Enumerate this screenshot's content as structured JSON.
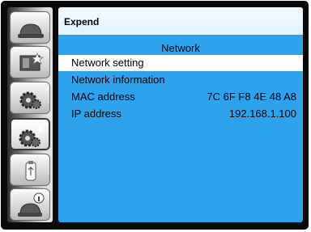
{
  "sidebar": {
    "items": [
      {
        "name": "display-icon"
      },
      {
        "name": "picture-icon"
      },
      {
        "name": "settings-gear-icon"
      },
      {
        "name": "expand-gear-icon"
      },
      {
        "name": "usb-icon"
      },
      {
        "name": "info-icon"
      }
    ]
  },
  "panel": {
    "title": "Expend",
    "section_title": "Network",
    "rows": [
      {
        "label": "Network setting",
        "value": ""
      },
      {
        "label": "Network information",
        "value": ""
      },
      {
        "label": "MAC address",
        "value": "7C 6F F8 4E 48 A8"
      },
      {
        "label": "IP address",
        "value": "192.168.1.100"
      }
    ],
    "selected_index": 0
  },
  "colors": {
    "panel_bg": "#2ea3ed",
    "header_bg": "#eaf6ff",
    "selected_row_bg": "#ffffff",
    "frame_bg": "#0a0a0a"
  }
}
